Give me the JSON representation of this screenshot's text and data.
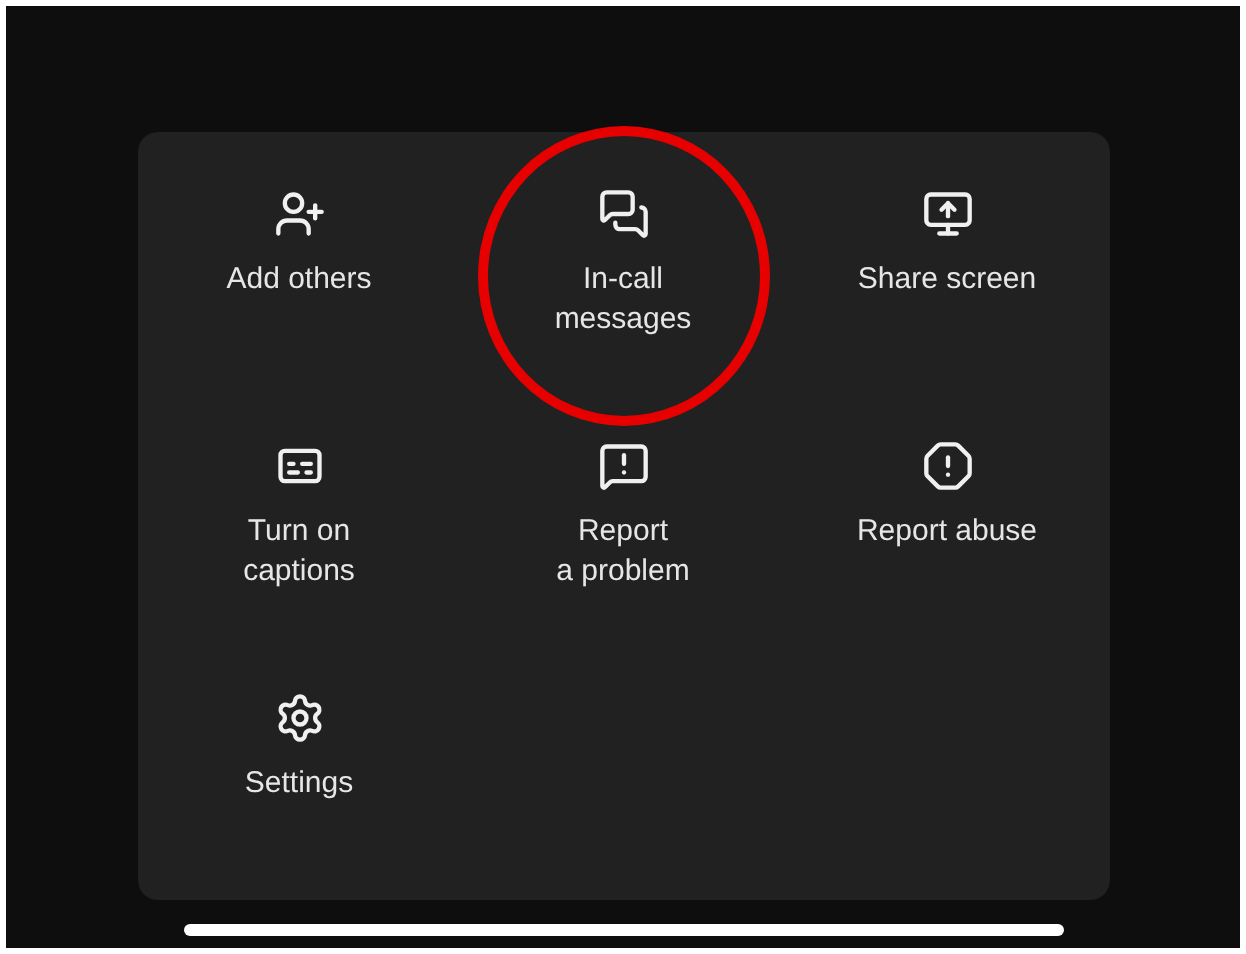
{
  "menu": {
    "items": [
      {
        "kind": "add-person",
        "label": "Add others",
        "highlighted": false
      },
      {
        "kind": "messages",
        "label": "In-call\nmessages",
        "highlighted": true
      },
      {
        "kind": "share-screen",
        "label": "Share screen",
        "highlighted": false
      },
      {
        "kind": "captions",
        "label": "Turn on\ncaptions",
        "highlighted": false
      },
      {
        "kind": "report-problem",
        "label": "Report\na problem",
        "highlighted": false
      },
      {
        "kind": "report-abuse",
        "label": "Report abuse",
        "highlighted": false
      },
      {
        "kind": "settings",
        "label": "Settings",
        "highlighted": false
      }
    ]
  }
}
